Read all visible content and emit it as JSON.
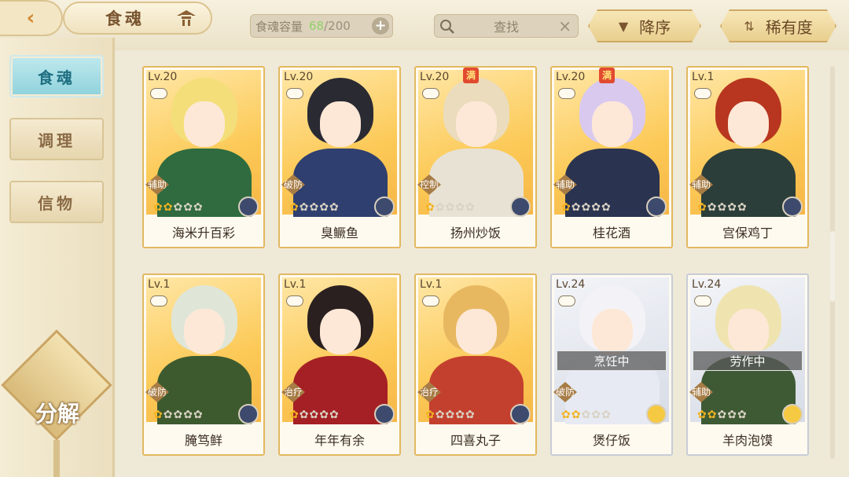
{
  "header": {
    "title": "食魂",
    "capacity_label": "食魂容量",
    "capacity_current": "68",
    "capacity_max": "/200",
    "search_placeholder": "查找",
    "sort_label": "降序",
    "rarity_label": "稀有度"
  },
  "sidebar": {
    "items": [
      {
        "label": "食魂",
        "active": true
      },
      {
        "label": "调理",
        "active": false
      },
      {
        "label": "信物",
        "active": false
      }
    ],
    "decompose_label": "分解"
  },
  "cards": [
    {
      "level": "Lv.20",
      "name": "海米升百彩",
      "role": "辅助",
      "full": false,
      "flames_on": 2,
      "status": "",
      "frame": "gold",
      "hair": "#f4de7a",
      "body": "#2f6b3f"
    },
    {
      "level": "Lv.20",
      "name": "臭鳜鱼",
      "role": "破防",
      "full": false,
      "flames_on": 1,
      "status": "",
      "frame": "gold",
      "hair": "#2a2a33",
      "body": "#2f3f6f"
    },
    {
      "level": "Lv.20",
      "name": "扬州炒饭",
      "role": "控制",
      "full": true,
      "full_label": "满",
      "flames_on": 1,
      "status": "",
      "frame": "gold",
      "hair": "#eadcbc",
      "body": "#e8e2d4"
    },
    {
      "level": "Lv.20",
      "name": "桂花酒",
      "role": "辅助",
      "full": true,
      "full_label": "满",
      "flames_on": 1,
      "status": "",
      "frame": "gold",
      "hair": "#d9c9ef",
      "body": "#2a3350"
    },
    {
      "level": "Lv.1",
      "name": "宫保鸡丁",
      "role": "辅助",
      "full": false,
      "flames_on": 1,
      "status": "",
      "frame": "gold",
      "hair": "#b8361f",
      "body": "#2c3e3a"
    },
    {
      "level": "Lv.1",
      "name": "腌笃鲜",
      "role": "破防",
      "full": false,
      "flames_on": 1,
      "status": "",
      "frame": "gold",
      "hair": "#dfe6d8",
      "body": "#3d5a2f"
    },
    {
      "level": "Lv.1",
      "name": "年年有余",
      "role": "治疗",
      "full": false,
      "flames_on": 1,
      "status": "",
      "frame": "gold",
      "hair": "#2b2020",
      "body": "#a52024"
    },
    {
      "level": "Lv.1",
      "name": "四喜丸子",
      "role": "治疗",
      "full": false,
      "flames_on": 1,
      "status": "",
      "frame": "gold",
      "hair": "#e8b861",
      "body": "#c4402e"
    },
    {
      "level": "Lv.24",
      "name": "煲仔饭",
      "role": "破防",
      "full": false,
      "flames_on": 2,
      "status": "烹饪中",
      "frame": "silver",
      "hair": "#f3f3f7",
      "body": "#e7eaf3"
    },
    {
      "level": "Lv.24",
      "name": "羊肉泡馍",
      "role": "辅助",
      "full": false,
      "flames_on": 2,
      "status": "劳作中",
      "frame": "silver",
      "hair": "#efe4b0",
      "body": "#3e5a34"
    }
  ]
}
